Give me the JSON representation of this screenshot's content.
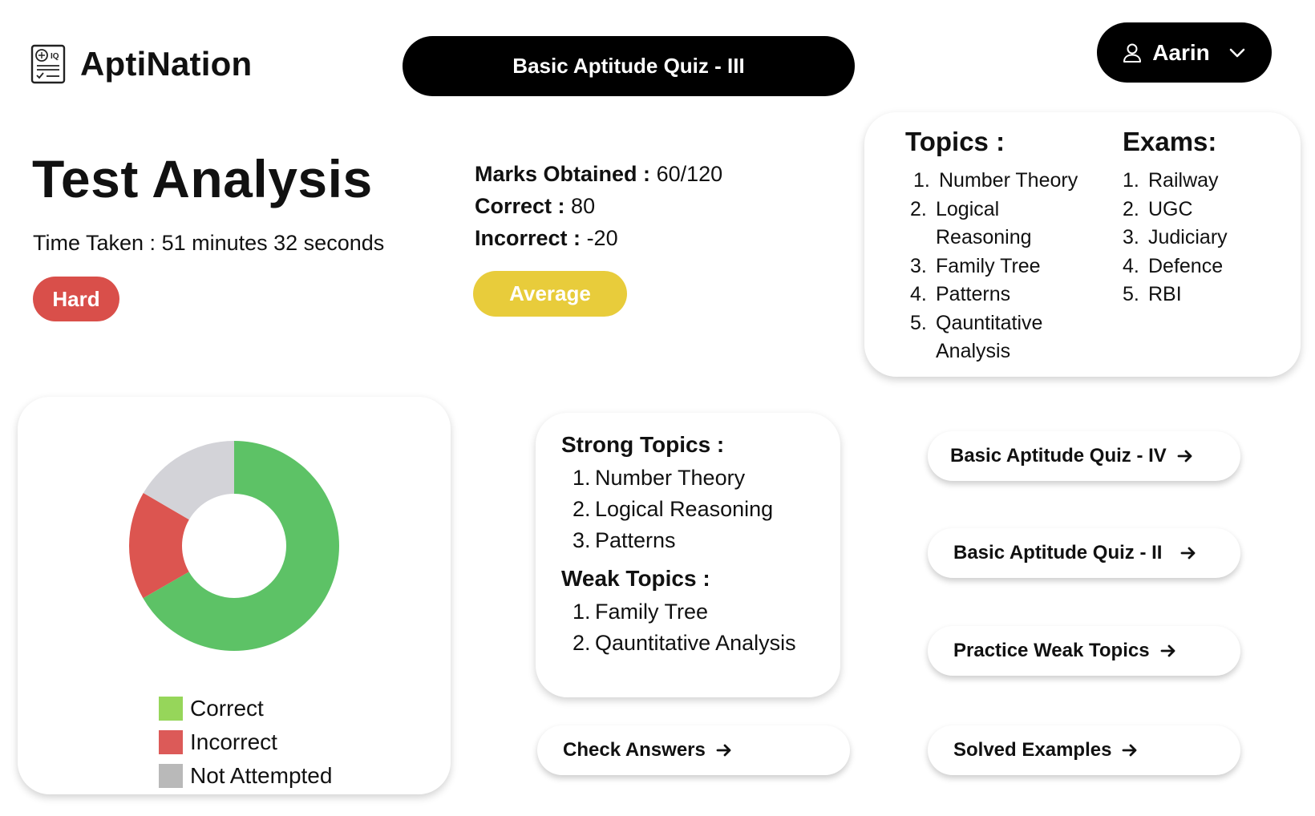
{
  "brand": {
    "name": "AptiNation",
    "icon": "brain-document-icon"
  },
  "header": {
    "quiz_title": "Basic Aptitude Quiz - III"
  },
  "user": {
    "name": "Aarin",
    "icon": "user-icon",
    "menu_icon": "chevron-down-icon"
  },
  "analysis": {
    "title": "Test Analysis",
    "time_taken": "Time Taken : 51 minutes 32 seconds",
    "difficulty": "Hard",
    "marks_label": "Marks Obtained :",
    "marks_value": "60/120",
    "correct_label": "Correct :",
    "correct_value": "80",
    "incorrect_label": "Incorrect :",
    "incorrect_value": "-20",
    "rating": "Average"
  },
  "topics": {
    "heading": "Topics :",
    "items": [
      {
        "num": "1.",
        "label": "Number Theory"
      },
      {
        "num": "2.",
        "label": "Logical Reasoning"
      },
      {
        "num": "3.",
        "label": "Family Tree"
      },
      {
        "num": "4.",
        "label": "Patterns"
      },
      {
        "num": "5.",
        "label": "Qauntitative Analysis"
      }
    ]
  },
  "exams": {
    "heading": "Exams:",
    "items": [
      {
        "num": "1.",
        "label": "Railway"
      },
      {
        "num": "2.",
        "label": "UGC"
      },
      {
        "num": "3.",
        "label": "Judiciary"
      },
      {
        "num": "4.",
        "label": "Defence"
      },
      {
        "num": "5.",
        "label": "RBI"
      }
    ]
  },
  "chart_data": {
    "type": "pie",
    "donut": true,
    "categories": [
      "Correct",
      "Incorrect",
      "Not Attempted"
    ],
    "values": [
      66.7,
      16.7,
      16.6
    ],
    "colors": [
      "#5dc266",
      "#dc5550",
      "#d3d3d8"
    ],
    "legend_colors": [
      "#96d65a",
      "#dc5a58",
      "#b9b9b9"
    ],
    "legend_placement": "bottom"
  },
  "strong_topics": {
    "heading": "Strong Topics :",
    "items": [
      {
        "num": "1.",
        "label": "Number Theory"
      },
      {
        "num": "2.",
        "label": "Logical Reasoning"
      },
      {
        "num": "3.",
        "label": "Patterns"
      }
    ]
  },
  "weak_topics": {
    "heading": "Weak Topics :",
    "items": [
      {
        "num": "1.",
        "label": "Family Tree"
      },
      {
        "num": "2.",
        "label": "Qauntitative Analysis"
      }
    ]
  },
  "actions": {
    "next_quiz": "Basic Aptitude Quiz - IV",
    "prev_quiz": "Basic Aptitude Quiz - II",
    "practice": "Practice Weak Topics",
    "check_answers": "Check Answers",
    "solved_examples": "Solved Examples",
    "arrow_icon": "arrow-right-icon"
  }
}
